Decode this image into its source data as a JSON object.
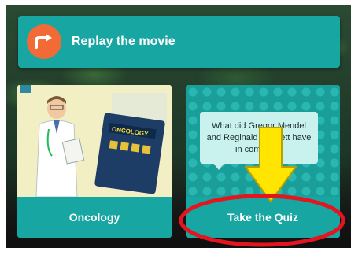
{
  "replay": {
    "label": "Replay the movie",
    "icon": "replay-arrow-icon"
  },
  "cards": {
    "oncology": {
      "title": "Oncology",
      "sign": "ONCOLOGY"
    },
    "quiz": {
      "title": "Take the Quiz",
      "question": "What did Gregor Mendel and Reginald Punnett have in common?"
    }
  },
  "colors": {
    "teal": "#17a6a2",
    "orange": "#f26a36",
    "annotation_red": "#e3151f",
    "annotation_yellow": "#ffe500"
  }
}
